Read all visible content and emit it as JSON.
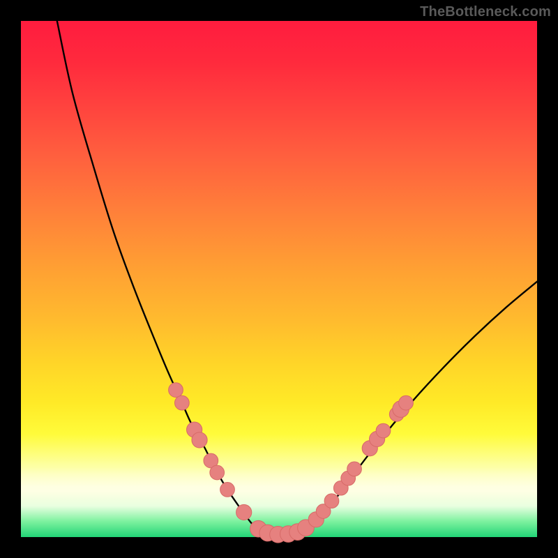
{
  "watermark": "TheBottleneck.com",
  "colors": {
    "curve": "#000000",
    "marker_fill": "#e6817f",
    "marker_stroke": "#d76a67"
  },
  "chart_data": {
    "type": "line",
    "title": "",
    "xlabel": "",
    "ylabel": "",
    "xlim": [
      0,
      100
    ],
    "ylim": [
      0,
      100
    ],
    "grid": false,
    "series": [
      {
        "name": "left-branch",
        "x": [
          7,
          10,
          14,
          18,
          22,
          26,
          28.5,
          31,
          33,
          35.5,
          37.5,
          39.5,
          41.5,
          43.5,
          45.0,
          46.3
        ],
        "y": [
          100,
          86,
          72,
          59,
          48,
          38,
          32,
          26.5,
          22,
          17.5,
          13.5,
          10,
          7,
          4.2,
          2.3,
          1.2
        ]
      },
      {
        "name": "valley",
        "x": [
          46.3,
          48,
          50,
          52,
          53.5,
          55,
          56.0
        ],
        "y": [
          1.2,
          0.6,
          0.4,
          0.5,
          0.8,
          1.4,
          2.2
        ]
      },
      {
        "name": "right-branch",
        "x": [
          56.0,
          58,
          61,
          64,
          67,
          71,
          76,
          82,
          88,
          94,
          100
        ],
        "y": [
          2.2,
          4.0,
          7.5,
          11.5,
          15.5,
          20.5,
          26.5,
          33,
          39,
          44.5,
          49.5
        ]
      }
    ],
    "markers": [
      {
        "x": 30.0,
        "y": 28.5,
        "r": 1.4
      },
      {
        "x": 31.2,
        "y": 26.0,
        "r": 1.4
      },
      {
        "x": 33.6,
        "y": 20.8,
        "r": 1.5
      },
      {
        "x": 34.6,
        "y": 18.8,
        "r": 1.5
      },
      {
        "x": 36.8,
        "y": 14.8,
        "r": 1.4
      },
      {
        "x": 38.0,
        "y": 12.5,
        "r": 1.4
      },
      {
        "x": 40.0,
        "y": 9.2,
        "r": 1.4
      },
      {
        "x": 43.2,
        "y": 4.8,
        "r": 1.5
      },
      {
        "x": 46.0,
        "y": 1.6,
        "r": 1.6
      },
      {
        "x": 47.8,
        "y": 0.8,
        "r": 1.6
      },
      {
        "x": 49.8,
        "y": 0.5,
        "r": 1.6
      },
      {
        "x": 51.8,
        "y": 0.6,
        "r": 1.6
      },
      {
        "x": 53.6,
        "y": 1.0,
        "r": 1.6
      },
      {
        "x": 55.2,
        "y": 1.8,
        "r": 1.6
      },
      {
        "x": 57.2,
        "y": 3.4,
        "r": 1.5
      },
      {
        "x": 58.6,
        "y": 5.0,
        "r": 1.4
      },
      {
        "x": 60.2,
        "y": 7.0,
        "r": 1.4
      },
      {
        "x": 62.0,
        "y": 9.5,
        "r": 1.4
      },
      {
        "x": 63.4,
        "y": 11.4,
        "r": 1.4
      },
      {
        "x": 64.6,
        "y": 13.2,
        "r": 1.4
      },
      {
        "x": 67.6,
        "y": 17.2,
        "r": 1.5
      },
      {
        "x": 69.0,
        "y": 19.0,
        "r": 1.5
      },
      {
        "x": 70.2,
        "y": 20.6,
        "r": 1.4
      },
      {
        "x": 72.8,
        "y": 23.8,
        "r": 1.4
      },
      {
        "x": 73.6,
        "y": 24.8,
        "r": 1.6
      },
      {
        "x": 74.6,
        "y": 26.0,
        "r": 1.4
      }
    ]
  }
}
